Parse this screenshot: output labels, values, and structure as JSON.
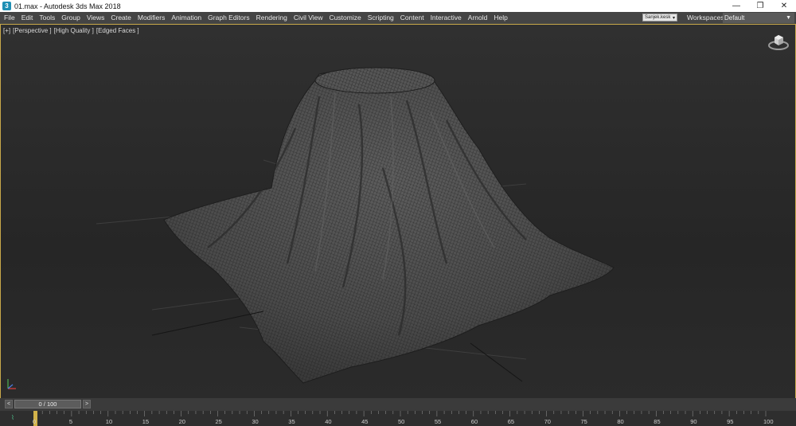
{
  "window": {
    "title": "01.max - Autodesk 3ds Max 2018",
    "controls": {
      "minimize": "—",
      "restore": "❐",
      "close": "✕"
    }
  },
  "menubar": {
    "items": [
      "File",
      "Edit",
      "Tools",
      "Group",
      "Views",
      "Create",
      "Modifiers",
      "Animation",
      "Graph Editors",
      "Rendering",
      "Civil View",
      "Customize",
      "Scripting",
      "Content",
      "Interactive",
      "Arnold",
      "Help"
    ],
    "user": "Sanjek.kesk",
    "workspaces_label": "Workspaces:",
    "workspace_value": "Default"
  },
  "viewport": {
    "labels": [
      "[+]",
      "[Perspective ]",
      "[High Quality ]",
      "[Edged Faces ]"
    ]
  },
  "trackbar": {
    "frame_counter": "0 / 100",
    "prev": "<",
    "next": ">"
  },
  "timeline": {
    "ticks": [
      "0",
      "5",
      "10",
      "15",
      "20",
      "25",
      "30",
      "35",
      "40",
      "45",
      "50",
      "55",
      "60",
      "65",
      "70",
      "75",
      "80",
      "85",
      "90",
      "95",
      "100"
    ],
    "mini_curve_icon": "⌇"
  }
}
